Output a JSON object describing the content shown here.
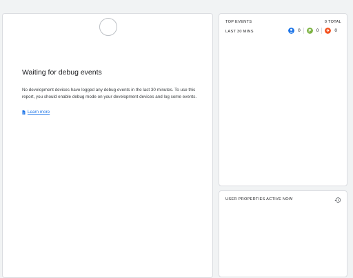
{
  "debug": {
    "heading": "Waiting for debug events",
    "body": "No development devices have logged any debug events in the last 30 minutes. To use this report, you should enable debug mode on your development devices and log some events.",
    "learn_more": "Learn more",
    "learn_more_icon": "doc-icon"
  },
  "top_events": {
    "title": "TOP EVENTS",
    "total": "0 TOTAL",
    "row_label": "LAST 30 MINS",
    "counts": [
      {
        "icon": "person-icon",
        "color": "#1a73e8",
        "value": "0"
      },
      {
        "icon": "flag-icon",
        "color": "#7cb342",
        "value": "0"
      },
      {
        "icon": "alert-icon",
        "color": "#f4511e",
        "value": "0"
      }
    ]
  },
  "user_properties": {
    "title": "USER PROPERTIES ACTIVE NOW",
    "icon": "history-icon"
  }
}
